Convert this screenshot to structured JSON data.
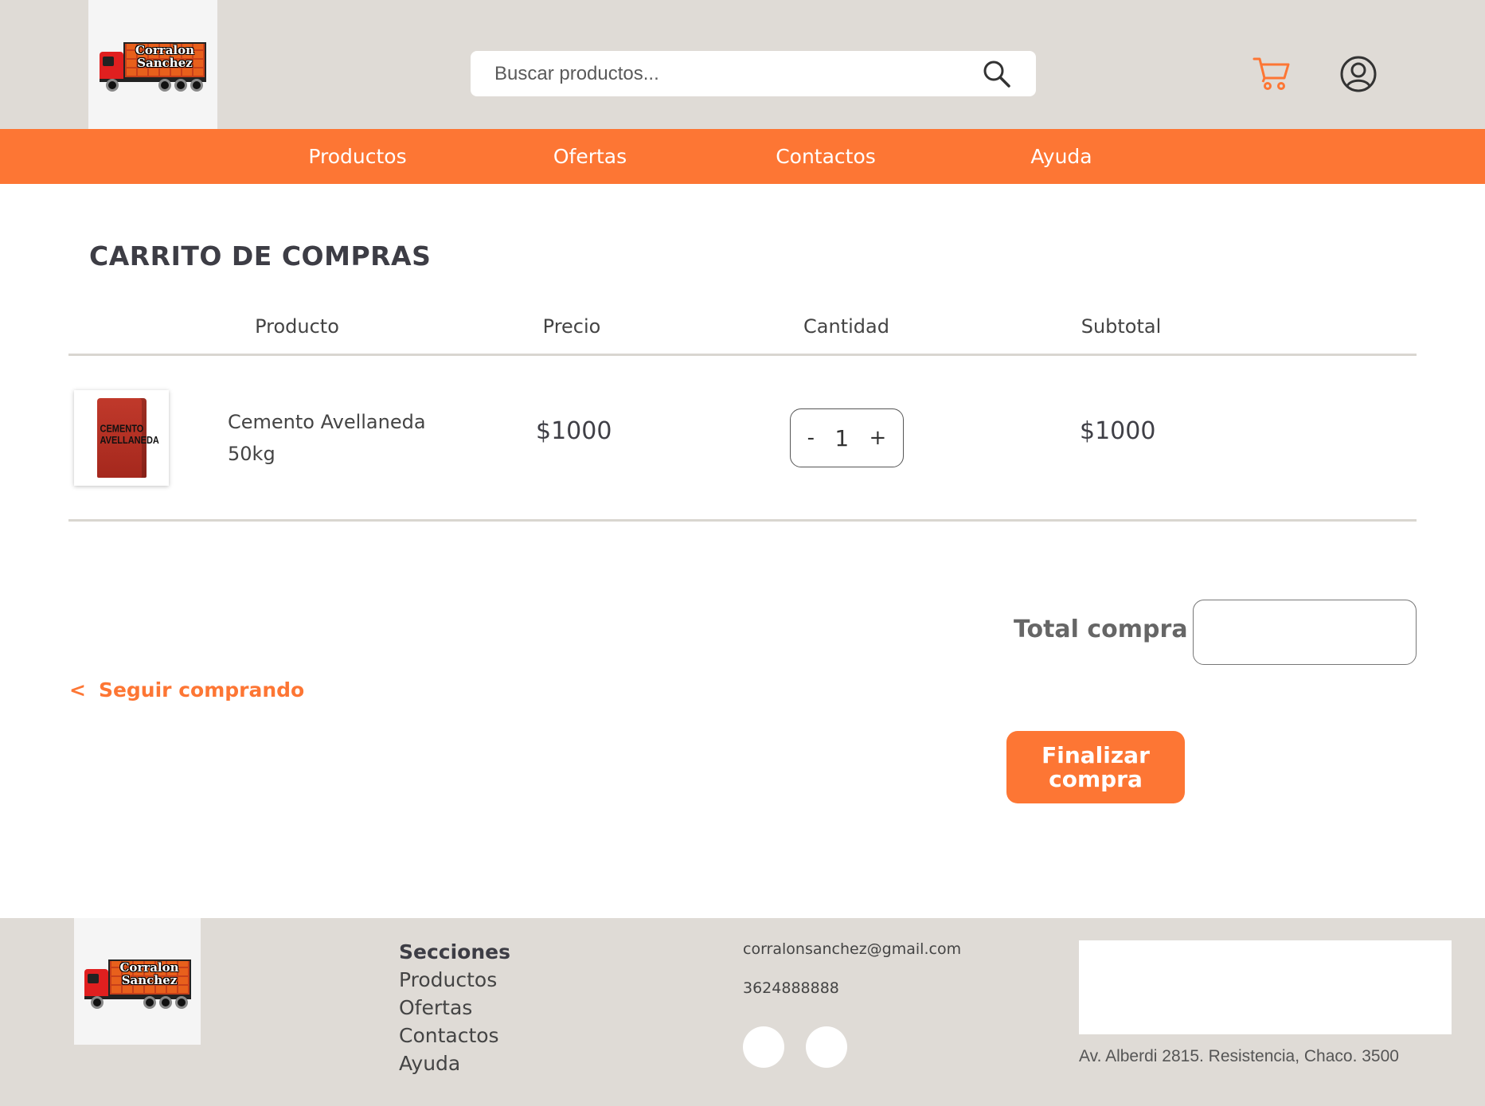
{
  "brand": {
    "logo_line1": "Corralon",
    "logo_line2": "Sanchez"
  },
  "header": {
    "search_placeholder": "Buscar productos..."
  },
  "nav": {
    "items": [
      "Productos",
      "Ofertas",
      "Contactos",
      "Ayuda"
    ]
  },
  "cart": {
    "title": "CARRITO DE COMPRAS",
    "columns": [
      "Producto",
      "Precio",
      "Cantidad",
      "Subtotal"
    ],
    "rows": [
      {
        "image_text": "CEMENTO AVELLANEDA",
        "name": "Cemento Avellaneda 50kg",
        "price": "$1000",
        "qty": "1",
        "subtotal": "$1000"
      }
    ],
    "qty_minus": "-",
    "qty_plus": "+",
    "total_label": "Total compra",
    "total_value": "",
    "continue_chevron": "<",
    "continue_label": "Seguir comprando",
    "finish_label": "Finalizar compra"
  },
  "footer": {
    "sections_title": "Secciones",
    "links": [
      "Productos",
      "Ofertas",
      "Contactos",
      "Ayuda"
    ],
    "email": "corralonsanchez@gmail.com",
    "phone": "3624888888",
    "address": "Av. Alberdi 2815. Resistencia, Chaco. 3500"
  },
  "colors": {
    "accent": "#fd7634",
    "header_bg": "#dfdbd6",
    "text": "#3f3f46"
  },
  "icons": [
    "search-icon",
    "cart-icon",
    "user-icon"
  ]
}
